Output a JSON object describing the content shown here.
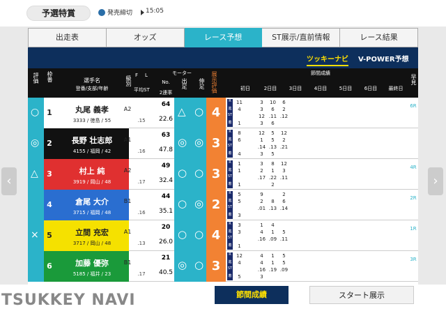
{
  "header": {
    "title": "予選特賞",
    "deadline_label": "発売締切",
    "deadline_time": "15:05"
  },
  "tabs": [
    {
      "label": "出走表"
    },
    {
      "label": "オッズ"
    },
    {
      "label": "レース予想"
    },
    {
      "label": "ST展示/直前情報"
    },
    {
      "label": "レース結果"
    }
  ],
  "subtabs": [
    {
      "label": "ツッキーナビ"
    },
    {
      "label": "V-POWER予想"
    }
  ],
  "columns": {
    "mark": "評価",
    "waku": "枠番",
    "racer": "選手名",
    "racer_sub": "登番/支部/年齢",
    "class": "級別",
    "f": "F",
    "l": "L",
    "avg_st": "平均ST",
    "motor": "モーター",
    "motor_no": "No.",
    "motor_rate": "2連率",
    "start": "出足",
    "nobi": "伸足",
    "pred": "展示評価",
    "session": "節間成績",
    "days": [
      "初日",
      "2日目",
      "3日目",
      "4日目",
      "5日目",
      "6日目",
      "最終日"
    ],
    "detail": "早見"
  },
  "racers": [
    {
      "mark": "○",
      "num": "1",
      "name": "丸尾 義孝",
      "info": "3333 / 徳島 / 55",
      "class": "A2",
      "avgst": ".15",
      "motor_no": "64",
      "motor_rate": "22.6",
      "start": "△",
      "nobi": "○",
      "pred": "4",
      "bg": "#ffffff",
      "color": "#222222",
      "detail": "6R"
    },
    {
      "mark": "◎",
      "num": "2",
      "name": "長野 壮志郎",
      "info": "4155 / 福岡 / 42",
      "class": "A1",
      "avgst": ".16",
      "motor_no": "63",
      "motor_rate": "47.8",
      "start": "◎",
      "nobi": "◎",
      "pred": "3",
      "bg": "#111111",
      "color": "#ffffff",
      "detail": ""
    },
    {
      "mark": "△",
      "num": "3",
      "name": "村上 純",
      "info": "3919 / 岡山 / 48",
      "class": "A2",
      "avgst": ".17",
      "motor_no": "49",
      "motor_rate": "32.4",
      "start": "○",
      "nobi": "○",
      "pred": "3",
      "bg": "#e03030",
      "color": "#ffffff",
      "detail": "4R"
    },
    {
      "mark": "",
      "num": "4",
      "name": "倉尾 大介",
      "info": "3715 / 福岡 / 48",
      "class": "B1",
      "avgst": ".16",
      "motor_no": "44",
      "motor_rate": "35.1",
      "start": "○",
      "nobi": "◎",
      "pred": "2",
      "bg": "#2a6ed0",
      "color": "#ffffff",
      "detail": "2R"
    },
    {
      "mark": "×",
      "num": "5",
      "name": "立間 充宏",
      "info": "3717 / 岡山 / 48",
      "class": "A1",
      "avgst": ".13",
      "motor_no": "20",
      "motor_rate": "26.0",
      "start": "○",
      "nobi": "○",
      "pred": "4",
      "bg": "#f5e100",
      "color": "#222222",
      "detail": "1R"
    },
    {
      "mark": "",
      "num": "6",
      "name": "加藤 優弥",
      "info": "5185 / 福井 / 23",
      "class": "B1",
      "avgst": ".17",
      "motor_no": "21",
      "motor_rate": "40.5",
      "start": "◎",
      "nobi": "○",
      "pred": "3",
      "bg": "#1a9a3a",
      "color": "#ffffff",
      "detail": "3R"
    }
  ],
  "lane_labels": [
    "R",
    "進",
    "ST",
    "着"
  ],
  "session_rows": [
    [
      [
        "11",
        "",
        "3",
        "10",
        "6"
      ],
      [
        "4",
        "",
        "3",
        "6",
        "2"
      ],
      [
        "",
        "",
        "12",
        ".11",
        ".12"
      ],
      [
        "1",
        "",
        "3",
        "6",
        ""
      ]
    ],
    [
      [
        "8",
        "",
        "12",
        "5",
        "12"
      ],
      [
        "6",
        "",
        "1",
        "5",
        "2"
      ],
      [
        "",
        "",
        ".14",
        ".13",
        ".21"
      ],
      [
        "4",
        "",
        "3",
        "5",
        ""
      ]
    ],
    [
      [
        "1",
        "",
        "3",
        "8",
        "12"
      ],
      [
        "1",
        "",
        "2",
        "1",
        "3"
      ],
      [
        "",
        "",
        ".17",
        ".22",
        ".11"
      ],
      [
        "1",
        "",
        "",
        "2",
        ""
      ]
    ],
    [
      [
        "5",
        "",
        "9",
        "",
        "2"
      ],
      [
        "5",
        "",
        "2",
        "8",
        "6"
      ],
      [
        "",
        "",
        ".01",
        ".13",
        ".14"
      ],
      [
        "3",
        "",
        "",
        "",
        ""
      ]
    ],
    [
      [
        "3",
        "",
        "1",
        "4",
        ""
      ],
      [
        "3",
        "",
        "4",
        "1",
        "5"
      ],
      [
        "",
        "",
        ".16",
        ".09",
        ".11"
      ],
      [
        "1",
        "",
        "",
        "",
        ""
      ]
    ],
    [
      [
        "12",
        "",
        "4",
        "1",
        "5"
      ],
      [
        "4",
        "",
        "4",
        "1",
        "5"
      ],
      [
        "",
        "",
        ".16",
        ".19",
        ".09"
      ],
      [
        "5",
        "",
        "3",
        "",
        ""
      ]
    ]
  ],
  "footer": {
    "logo": "TSUKKEY NAVI",
    "btn1": "節間成績",
    "btn2": "スタート展示"
  }
}
